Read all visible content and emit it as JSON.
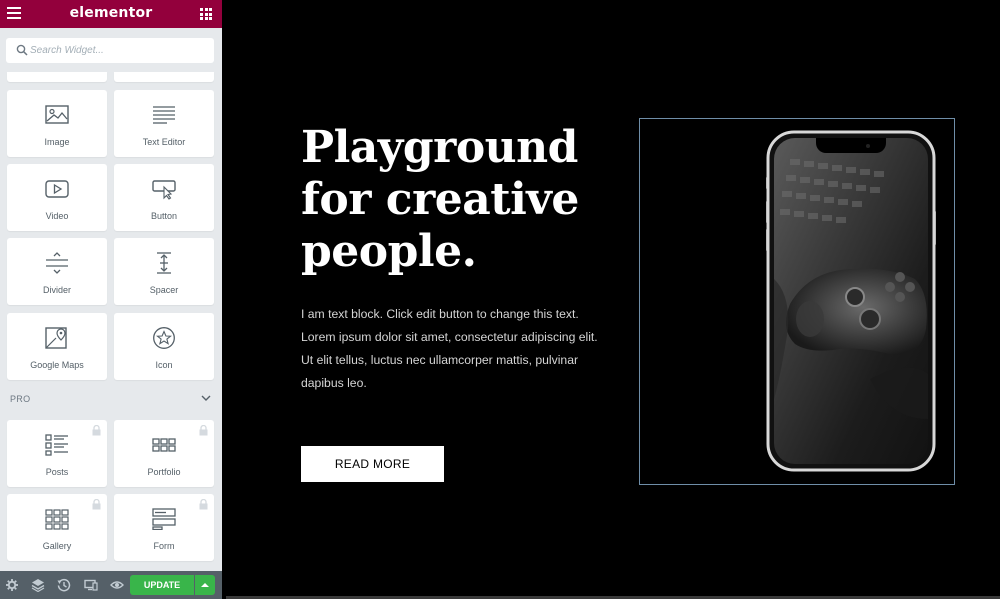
{
  "app": {
    "brand": "elementor"
  },
  "search": {
    "placeholder": "Search Widget..."
  },
  "widgets": [
    {
      "label": "Image",
      "icon": "image-icon"
    },
    {
      "label": "Text Editor",
      "icon": "text-editor-icon"
    },
    {
      "label": "Video",
      "icon": "video-icon"
    },
    {
      "label": "Button",
      "icon": "button-icon"
    },
    {
      "label": "Divider",
      "icon": "divider-icon"
    },
    {
      "label": "Spacer",
      "icon": "spacer-icon"
    },
    {
      "label": "Google Maps",
      "icon": "google-maps-icon"
    },
    {
      "label": "Icon",
      "icon": "star-icon"
    }
  ],
  "pro": {
    "label": "PRO",
    "widgets": [
      {
        "label": "Posts",
        "icon": "posts-icon",
        "locked": true
      },
      {
        "label": "Portfolio",
        "icon": "portfolio-icon",
        "locked": true
      },
      {
        "label": "Gallery",
        "icon": "gallery-icon",
        "locked": true
      },
      {
        "label": "Form",
        "icon": "form-icon",
        "locked": true
      }
    ]
  },
  "footer": {
    "update_label": "UPDATE"
  },
  "hero": {
    "headline": [
      "Playground",
      "for creative",
      "people."
    ],
    "body": "I am text block. Click edit button to change this text. Lorem ipsum dolor sit amet, consectetur adipiscing elit. Ut elit tellus, luctus nec ullamcorper mattis, pulvinar dapibus leo.",
    "button": "READ MORE"
  },
  "colors": {
    "topbar": "#93003c",
    "sidebar_bg": "#e6e9ec",
    "update_green": "#39b54a",
    "canvas_bg": "#000000"
  }
}
